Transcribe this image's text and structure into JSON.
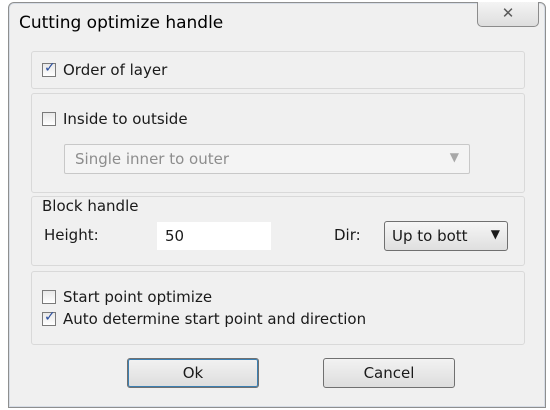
{
  "window": {
    "title": "Cutting optimize handle",
    "close_glyph": "✕"
  },
  "order_of_layer": {
    "label": "Order of layer",
    "checked": true
  },
  "inside_outside": {
    "label": "Inside to outside",
    "checked": false,
    "mode_select": {
      "value": "Single inner to outer",
      "enabled": false
    }
  },
  "block_handle": {
    "title": "Block handle",
    "height_label": "Height:",
    "height_value": "50",
    "dir_label": "Dir:",
    "dir_value": "Up to bott"
  },
  "start_point": {
    "optimize_label": "Start point optimize",
    "optimize_checked": false,
    "auto_label": "Auto determine start point and direction",
    "auto_checked": true
  },
  "buttons": {
    "ok": "Ok",
    "cancel": "Cancel"
  }
}
